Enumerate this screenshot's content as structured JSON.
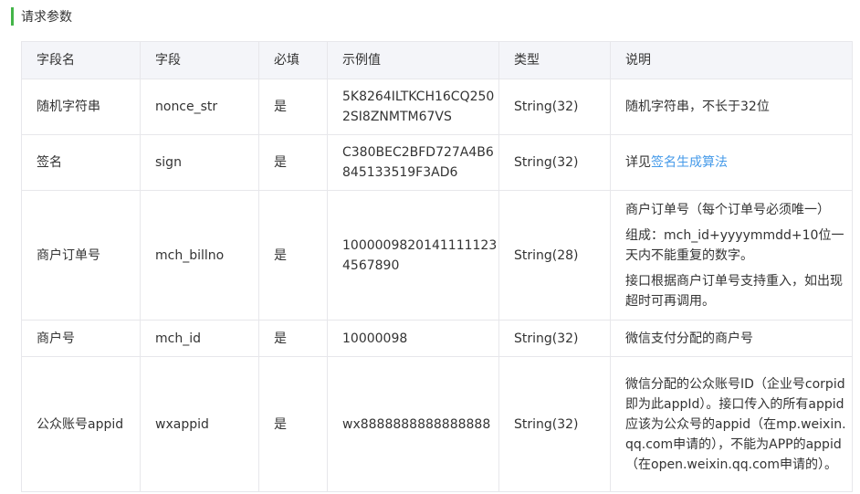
{
  "section": {
    "title": "请求参数"
  },
  "headers": [
    "字段名",
    "字段",
    "必填",
    "示例值",
    "类型",
    "说明"
  ],
  "rows": [
    {
      "name": "随机字符串",
      "field": "nonce_str",
      "required": "是",
      "example": "5K8264ILTKCH16CQ2502SI8ZNMTM67VS",
      "type": "String(32)",
      "desc": "随机字符串，不长于32位"
    },
    {
      "name": "签名",
      "field": "sign",
      "required": "是",
      "example": "C380BEC2BFD727A4B6845133519F3AD6",
      "type": "String(32)",
      "desc_prefix": "详见",
      "desc_link": "签名生成算法"
    },
    {
      "name": "商户订单号",
      "field": "mch_billno",
      "required": "是",
      "example": "10000098201411111234567890",
      "type": "String(28)",
      "desc_lines": [
        "商户订单号（每个订单号必须唯一）",
        "组成：mch_id+yyyymmdd+10位一天内不能重复的数字。",
        "接口根据商户订单号支持重入，如出现超时可再调用。"
      ]
    },
    {
      "name": "商户号",
      "field": "mch_id",
      "required": "是",
      "example": "10000098",
      "type": "String(32)",
      "desc": "微信支付分配的商户号"
    },
    {
      "name": "公众账号appid",
      "field": "wxappid",
      "required": "是",
      "example": "wx8888888888888888",
      "type": "String(32)",
      "desc": "微信分配的公众账号ID（企业号corpid即为此appId）。接口传入的所有appid应该为公众号的appid（在mp.weixin.qq.com申请的），不能为APP的appid（在open.weixin.qq.com申请的）。"
    }
  ]
}
